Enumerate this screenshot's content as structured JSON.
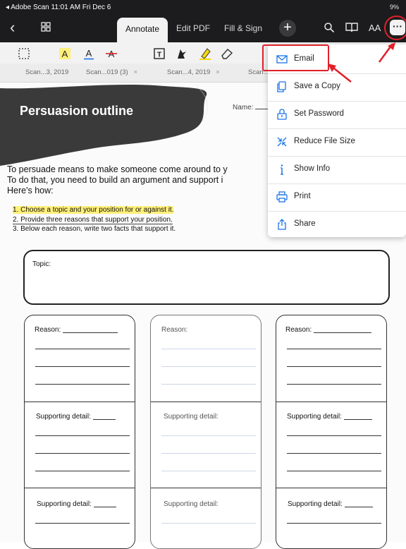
{
  "status_bar": {
    "left": "◂ Adobe Scan   11:01 AM   Fri Dec 6",
    "right": "9%"
  },
  "nav": {
    "tabs": [
      {
        "label": "Annotate",
        "active": true
      },
      {
        "label": "Edit PDF"
      },
      {
        "label": "Fill & Sign"
      }
    ],
    "more_label": "···",
    "plus_label": "+",
    "back_label": "‹",
    "font_size_label": "AA"
  },
  "toolbar": {
    "tools": [
      "select-rect",
      "highlight-text",
      "underline-text",
      "strikethrough-text",
      "add-text",
      "draw",
      "highlighter",
      "eraser"
    ]
  },
  "doc_tabs": [
    {
      "label": "Scan...3, 2019",
      "closable": false
    },
    {
      "label": "Scan...019 (3)",
      "closable": true
    },
    {
      "label": "Scan...4, 2019",
      "closable": true
    },
    {
      "label": "Scan...",
      "closable": false
    }
  ],
  "document": {
    "title": "Persuasion outline",
    "name_label": "Name:",
    "intro": [
      "To persuade means to make someone come around to y",
      "To do that, you need to build an argument and support i",
      "Here's how:"
    ],
    "steps": [
      "1.  Choose a topic and your position for or against it.",
      "2.  Provide three reasons that support your position.",
      "3.  Below each reason, write two facts that support it."
    ],
    "topic_label": "Topic:",
    "reason_label": "Reason:",
    "supporting_label": "Supporting detail:"
  },
  "menu": {
    "items": [
      {
        "label": "Email",
        "icon": "mail-icon"
      },
      {
        "label": "Save a Copy",
        "icon": "copy-icon"
      },
      {
        "label": "Set Password",
        "icon": "lock-icon"
      },
      {
        "label": "Reduce File Size",
        "icon": "compress-icon"
      },
      {
        "label": "Show Info",
        "icon": "info-icon"
      },
      {
        "label": "Print",
        "icon": "printer-icon"
      },
      {
        "label": "Share",
        "icon": "share-icon"
      }
    ]
  },
  "colors": {
    "accent": "#1a73e8",
    "annotation": "#e0202a",
    "highlight": "#fff07a"
  }
}
